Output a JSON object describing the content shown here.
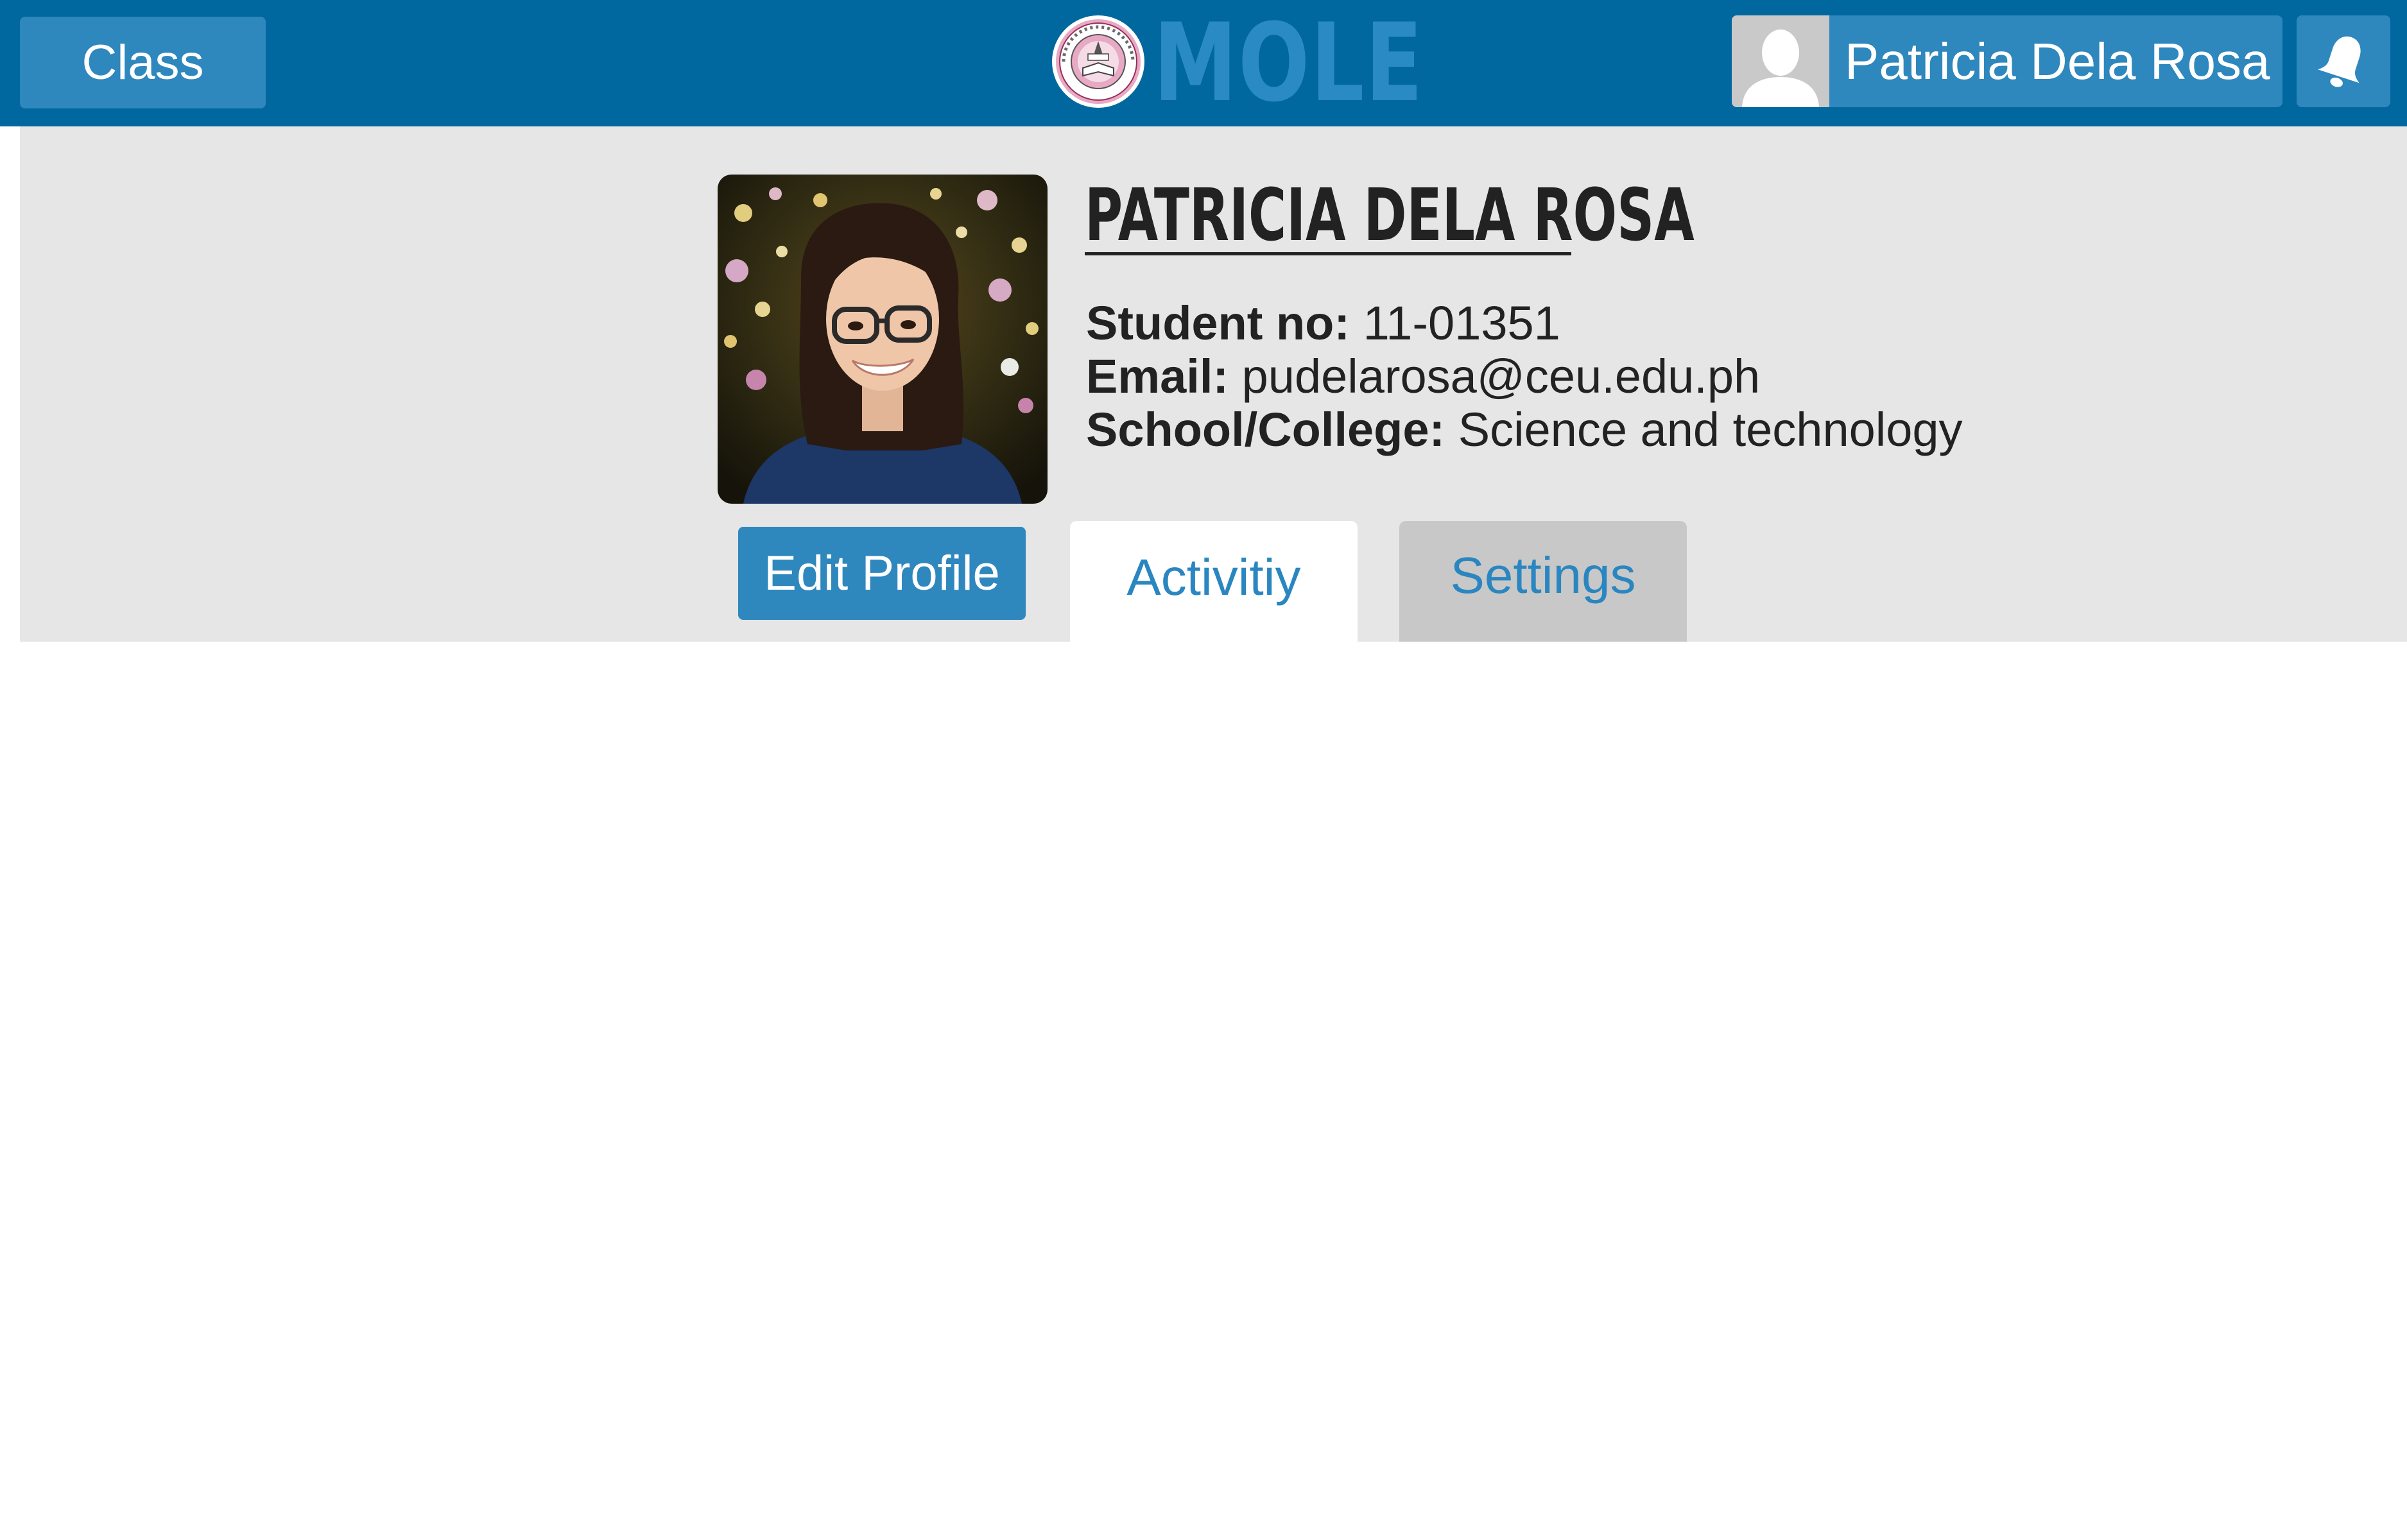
{
  "topbar": {
    "class_label": "Class",
    "logo_text": "MOLE",
    "logo_seal_icon": "university-seal-icon",
    "user_name": "Patricia Dela Rosa",
    "notification_icon": "bell-icon",
    "background_color": "#01689f",
    "button_color": "#2e87bd"
  },
  "profile": {
    "name": "PATRICIA DELA ROSA",
    "student_no_label": "Student no:",
    "student_no": "11-01351",
    "email_label": "Email:",
    "email": "pudelarosa@ceu.edu.ph",
    "school_label": "School/College:",
    "school": "Science and technology"
  },
  "tabs": {
    "edit_profile": "Edit Profile",
    "activity": "Activitiy",
    "settings": "Settings",
    "selected": "Activitiy"
  }
}
